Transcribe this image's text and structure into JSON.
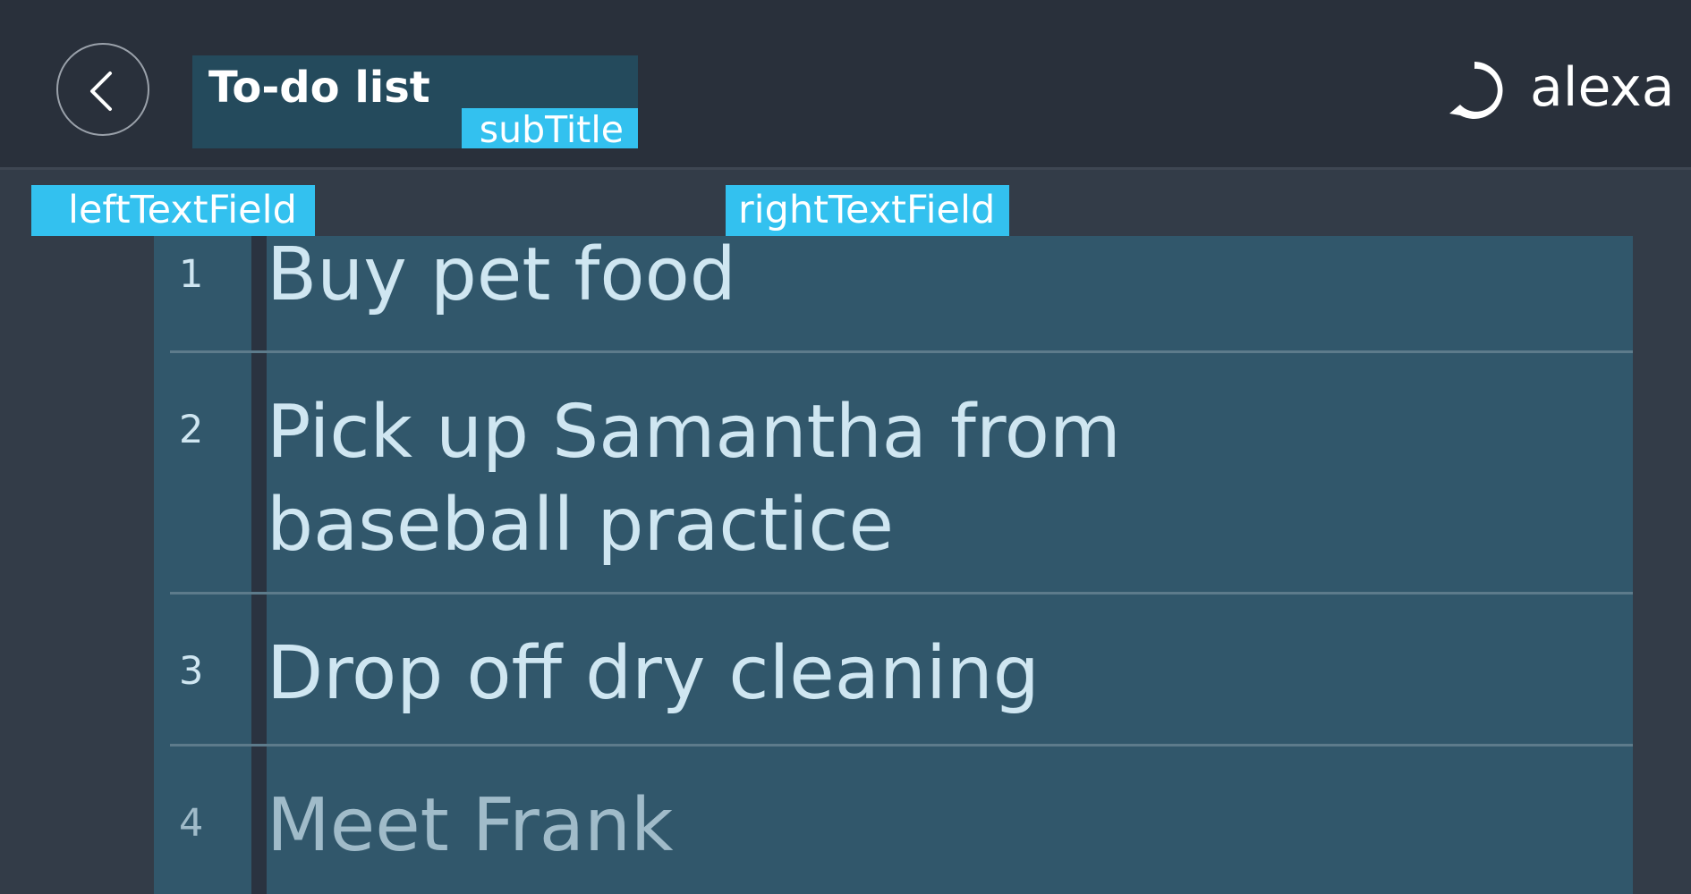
{
  "header": {
    "title": "To-do list",
    "subtitle": "subTitle",
    "back_icon": "chevron-left-icon",
    "logo_text": "alexa",
    "logo_icon": "alexa-ring-icon"
  },
  "fields": {
    "left": "leftTextField",
    "right": "rightTextField"
  },
  "list": {
    "items": [
      {
        "number": "1",
        "text": "Buy pet food"
      },
      {
        "number": "2",
        "text": "Pick up Samantha from baseball practice"
      },
      {
        "number": "3",
        "text": "Drop off dry cleaning"
      },
      {
        "number": "4",
        "text": "Meet Frank"
      }
    ]
  },
  "colors": {
    "background": "#333c48",
    "header": "#29303b",
    "accent": "#33c1ef",
    "list_background": "#31576b",
    "text": "#cfe6f1"
  }
}
